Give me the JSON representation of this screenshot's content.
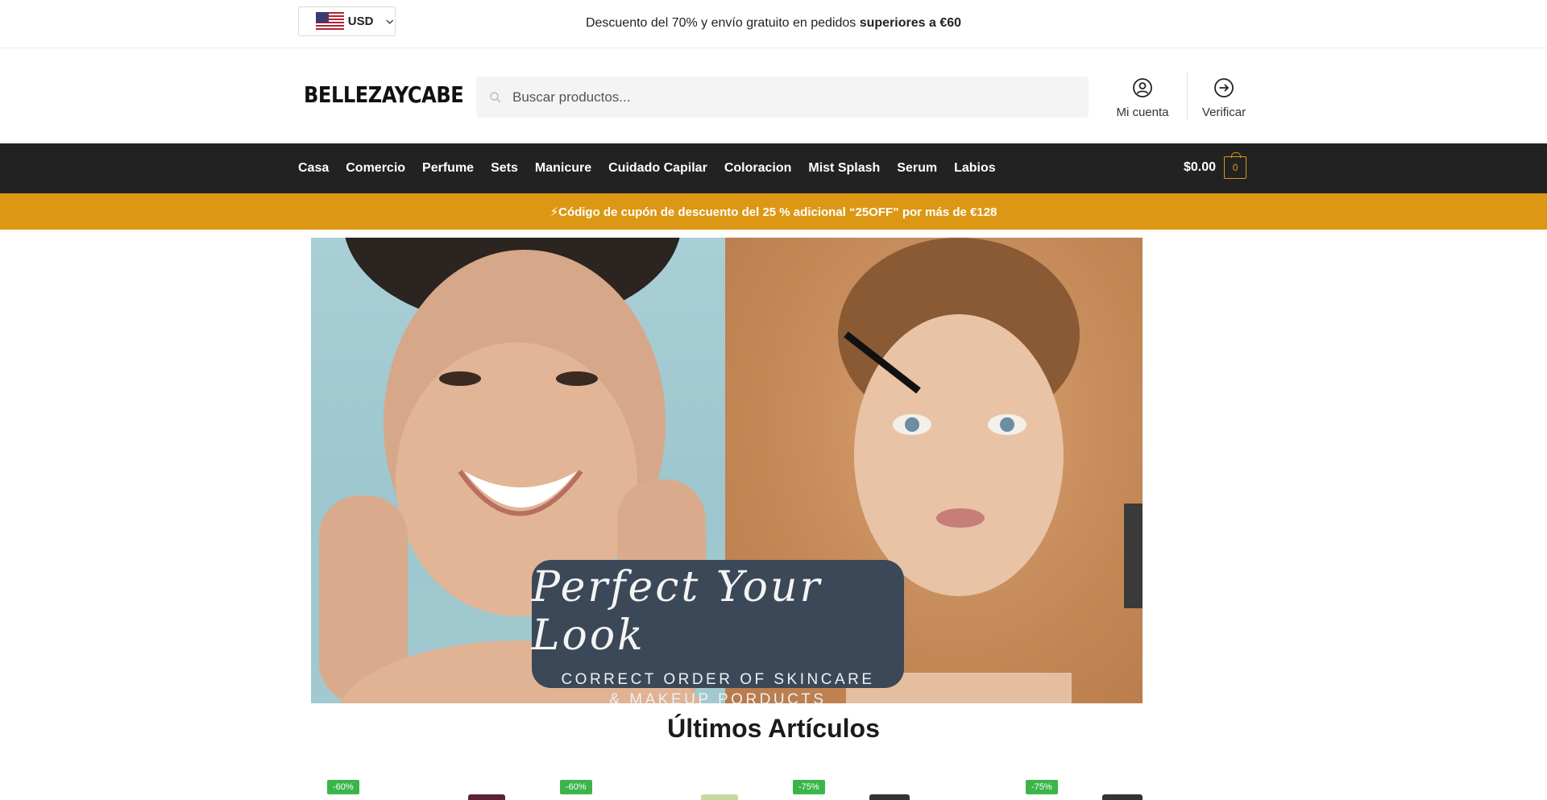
{
  "topbar": {
    "currency": "USD",
    "announcement_prefix": "Descuento del 70% y envío gratuito en pedidos ",
    "announcement_bold": "superiores a €60"
  },
  "header": {
    "logo": "BELLEZAYCABE",
    "search_placeholder": "Buscar productos...",
    "account_label": "Mi cuenta",
    "verify_label": "Verificar"
  },
  "nav": {
    "items": [
      "Casa",
      "Comercio",
      "Perfume",
      "Sets",
      "Manicure",
      "Cuidado Capilar",
      "Coloracion",
      "Mist Splash",
      "Serum",
      "Labios"
    ],
    "cart_total": "$0.00",
    "cart_count": "0"
  },
  "coupon": {
    "text": "⚡Código de cupón de descuento del 25 % adicional “25OFF” por más de €128"
  },
  "hero": {
    "script_title": "Perfect Your Look",
    "subtitle_line1": "CORRECT ORDER OF SKINCARE",
    "subtitle_line2": "& MAKEUP PORDUCTS"
  },
  "latest": {
    "title": "Últimos Artículos",
    "products": [
      {
        "badge": "-60%"
      },
      {
        "badge": "-60%"
      },
      {
        "badge": "-75%"
      },
      {
        "badge": "-75%"
      }
    ]
  },
  "colors": {
    "nav_bg": "#222222",
    "accent": "#dc9814",
    "badge": "#3bb54a",
    "caption_bg": "#3b4858"
  }
}
